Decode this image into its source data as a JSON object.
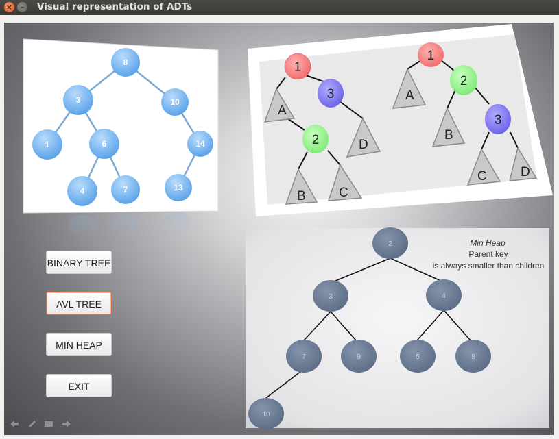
{
  "window": {
    "title": "Visual representation of ADTs",
    "close_glyph": "×",
    "minimize_glyph": "–"
  },
  "buttons": {
    "binary_tree": "BINARY TREE",
    "avl_tree": "AVL TREE",
    "min_heap": "MIN HEAP",
    "exit": "EXIT"
  },
  "bst_image": {
    "nodes": [
      "8",
      "3",
      "10",
      "1",
      "6",
      "14",
      "4",
      "7",
      "13"
    ]
  },
  "avl_image": {
    "left_tree": {
      "nodes": [
        "1",
        "3",
        "2"
      ],
      "subtrees": [
        "A",
        "B",
        "C",
        "D"
      ]
    },
    "right_tree": {
      "nodes": [
        "1",
        "2",
        "3"
      ],
      "subtrees": [
        "A",
        "B",
        "C",
        "D"
      ]
    }
  },
  "heap_image": {
    "title": "Min Heap",
    "line1": "Parent key",
    "line2": "is always smaller than children",
    "nodes": [
      "2",
      "3",
      "4",
      "7",
      "9",
      "5",
      "8",
      "10"
    ]
  },
  "colors": {
    "bst_node": "#6fb0ee",
    "avl_red": "#f47a7a",
    "avl_blue": "#7b72ec",
    "avl_green": "#8bf07f",
    "heap_node": "#6d7d96",
    "accent_orange": "#e0653a"
  },
  "icons": [
    "back-arrow-icon",
    "pencil-icon",
    "list-icon",
    "forward-arrow-icon"
  ]
}
